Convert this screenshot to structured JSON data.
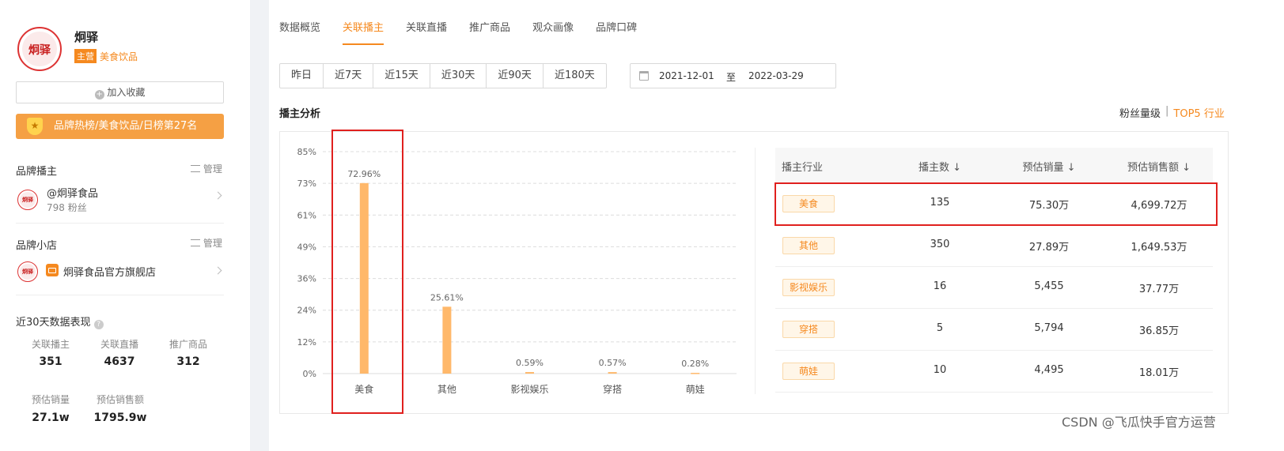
{
  "brand": {
    "name": "炯驿",
    "logo_text": "炯驿",
    "main_tag": "主营",
    "category": "美食饮品",
    "fav_button": "加入收藏",
    "rank_text": "品牌热榜/美食饮品/日榜第27名"
  },
  "sections": {
    "anchor_title": "品牌播主",
    "anchor_manage": "管理",
    "anchor_name": "@炯驿食品",
    "anchor_fans": "798 粉丝",
    "shop_title": "品牌小店",
    "shop_manage": "管理",
    "shop_name": "炯驿食品官方旗舰店",
    "perf_title": "近30天数据表现"
  },
  "stats": [
    {
      "label": "关联播主",
      "value": "351"
    },
    {
      "label": "关联直播",
      "value": "4637"
    },
    {
      "label": "推广商品",
      "value": "312"
    },
    {
      "label": "预估销量",
      "value": "27.1w"
    },
    {
      "label": "预估销售额",
      "value": "1795.9w"
    }
  ],
  "tabs": [
    "数据概览",
    "关联播主",
    "关联直播",
    "推广商品",
    "观众画像",
    "品牌口碑"
  ],
  "ranges": [
    "昨日",
    "近7天",
    "近15天",
    "近30天",
    "近90天",
    "近180天"
  ],
  "date": {
    "start": "2021-12-01",
    "sep": "至",
    "end": "2022-03-29"
  },
  "analysis": {
    "title": "播主分析",
    "link_fans": "粉丝量级",
    "pipe": "|",
    "link_top5": "TOP5 行业"
  },
  "chart_data": {
    "type": "bar",
    "categories": [
      "美食",
      "其他",
      "影视娱乐",
      "穿搭",
      "萌娃"
    ],
    "values": [
      72.96,
      25.61,
      0.59,
      0.57,
      0.28
    ],
    "labels": [
      "72.96%",
      "25.61%",
      "0.59%",
      "0.57%",
      "0.28%"
    ],
    "yticks": [
      "0%",
      "12%",
      "24%",
      "36%",
      "49%",
      "61%",
      "73%",
      "85%"
    ],
    "ylim": [
      0,
      85
    ],
    "grid": true,
    "bar_color": "#ffb86a"
  },
  "table": {
    "headers": [
      "播主行业",
      "播主数 ↓",
      "预估销量 ↓",
      "预估销售额 ↓"
    ],
    "rows": [
      {
        "industry": "美食",
        "count": "135",
        "volume": "75.30万",
        "amount": "4,699.72万"
      },
      {
        "industry": "其他",
        "count": "350",
        "volume": "27.89万",
        "amount": "1,649.53万"
      },
      {
        "industry": "影视娱乐",
        "count": "16",
        "volume": "5,455",
        "amount": "37.77万"
      },
      {
        "industry": "穿搭",
        "count": "5",
        "volume": "5,794",
        "amount": "36.85万"
      },
      {
        "industry": "萌娃",
        "count": "10",
        "volume": "4,495",
        "amount": "18.01万"
      }
    ]
  },
  "watermark": "CSDN @飞瓜快手官方运营",
  "colors": {
    "accent": "#f5891f",
    "highlight": "#e0201e"
  }
}
